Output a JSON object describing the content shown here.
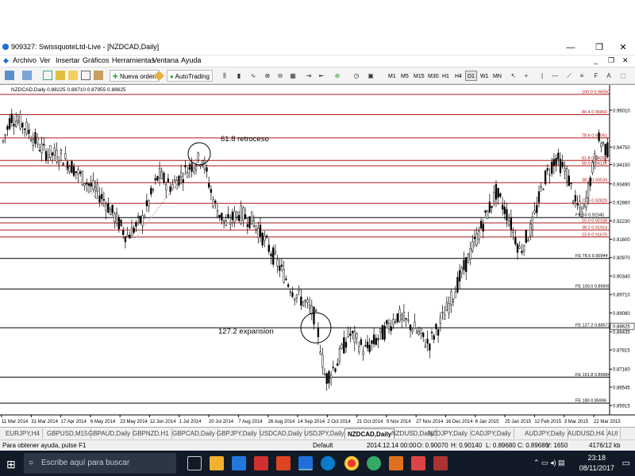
{
  "window": {
    "title": "909327: SwissquoteLtd-Live - [NZDCAD,Daily]",
    "controls": [
      "—",
      "❐",
      "✕"
    ],
    "inner_controls": [
      "_",
      "❐",
      "✕"
    ]
  },
  "menu": [
    "Archivo",
    "Ver",
    "Insertar",
    "Gráficos",
    "Herramientas",
    "Ventana",
    "Ayuda"
  ],
  "toolbar": {
    "new_order": "Nueva orden",
    "autotrading": "AutoTrading",
    "timeframes": [
      "M1",
      "M5",
      "M15",
      "M30",
      "H1",
      "H4",
      "D1",
      "W1",
      "MN"
    ]
  },
  "chart": {
    "header": "NZDCAD,Daily  0.88225 0.88710 0.87955 0.88625",
    "annotation_retrace": "61.8 retroceso",
    "annotation_expansion": "127.2 expansion",
    "price_axis": [
      "0.96010",
      "0.94750",
      "0.94150",
      "0.93490",
      "0.92860",
      "0.92230",
      "0.91600",
      "0.90970",
      "0.90340",
      "0.89710",
      "0.89080",
      "0.88435",
      "0.87815",
      "0.87160",
      "0.86545",
      "0.85915"
    ],
    "current_price": "0.88625",
    "date_axis": [
      "11 Mar 2014",
      "31 Mar 2014",
      "17 Apr 2014",
      "6 May 2014",
      "23 May 2014",
      "12 Jun 2014",
      "1 Jul 2014",
      "20 Jul 2014",
      "7 Aug 2014",
      "26 Aug 2014",
      "14 Sep 2014",
      "2 Oct 2014",
      "21 Oct 2014",
      "9 Nov 2014",
      "27 Nov 2014",
      "16 Dec 2014",
      "6 Jan 2015",
      "25 Jan 2015",
      "12 Feb 2015",
      "3 Mar 2015",
      "22 Mar 2015"
    ],
    "level_labels": [
      {
        "text": "100.0  0.96550"
      },
      {
        "text": "86.4  0.95860"
      },
      {
        "text": "78.6  0.95061"
      },
      {
        "text": "61.8  0.94292"
      },
      {
        "text": "50.0  0.94110"
      },
      {
        "text": "38.2  0.93534"
      },
      {
        "text": "23.6  0.92829"
      },
      {
        "text": "FE 50  0.92340"
      },
      {
        "text": "10.0  0.92158"
      },
      {
        "text": "38.2  0.91914"
      },
      {
        "text": "23.6  0.91675"
      },
      {
        "text": "FE 78.6  0.90944"
      },
      {
        "text": "FE 100.0  0.89900"
      },
      {
        "text": "FE 127.2  0.88573"
      },
      {
        "text": "FE 161.8  0.86884"
      },
      {
        "text": "FE 180  0.85996"
      }
    ],
    "colors": {
      "level_red": "#b01818",
      "level_black": "#000000",
      "candle": "#000000",
      "annotation_dots": "#d08080"
    }
  },
  "tabs": [
    "EURJPY,H4",
    "GBPUSD,M15",
    "GBPAUD,Daily",
    "GBPNZD,H1",
    "GBPCAD,Daily",
    "GBPJPY,Daily",
    "USDCAD,Daily",
    "USDJPY,Daily",
    "NZDCAD,Daily",
    "NZDUSD,Daily",
    "NZDJPY,Daily",
    "CADJPY,Daily",
    "AUDJPY,Daily",
    "AUDUSD,H4",
    "AUI"
  ],
  "active_tab": "NZDCAD,Daily",
  "status": {
    "help": "Para obtener ayuda, pulse F1",
    "profile": "Default",
    "datetime": "2014.12.14 00:00",
    "open": "O: 0.90070",
    "high": "H: 0.90140",
    "low": "L: 0.89680",
    "close": "C: 0.89680",
    "volume": "V: 1650",
    "traffic": "4176/12 kb"
  },
  "taskbar": {
    "search_placeholder": "Escribe aquí para buscar",
    "time": "23:18",
    "date": "08/11/2017"
  }
}
